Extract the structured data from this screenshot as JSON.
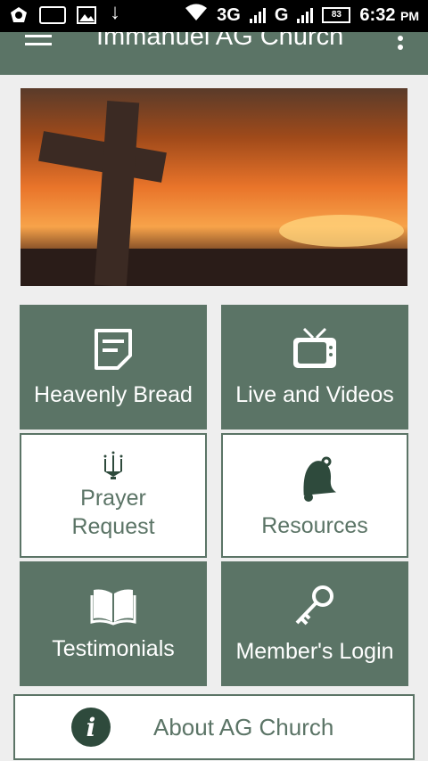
{
  "status_bar": {
    "network_1": "3G",
    "network_2": "G",
    "battery": "83",
    "time": "6:32",
    "ampm": "PM"
  },
  "app_bar": {
    "title": "Immanuel AG Church"
  },
  "tiles": [
    {
      "label": "Heavenly Bread",
      "icon": "note-icon"
    },
    {
      "label": "Live and Videos",
      "icon": "tv-icon"
    },
    {
      "label": "Prayer\nRequest",
      "icon": "candle-icon"
    },
    {
      "label": "Resources",
      "icon": "bell-icon"
    },
    {
      "label": "Testimonials",
      "icon": "book-icon"
    },
    {
      "label": "Member's Login",
      "icon": "key-icon"
    }
  ],
  "about": {
    "label": "About AG Church",
    "icon": "info-icon"
  },
  "colors": {
    "primary": "#5b7466",
    "dark_accent": "#2e4a3c",
    "background": "#eeeeee"
  }
}
